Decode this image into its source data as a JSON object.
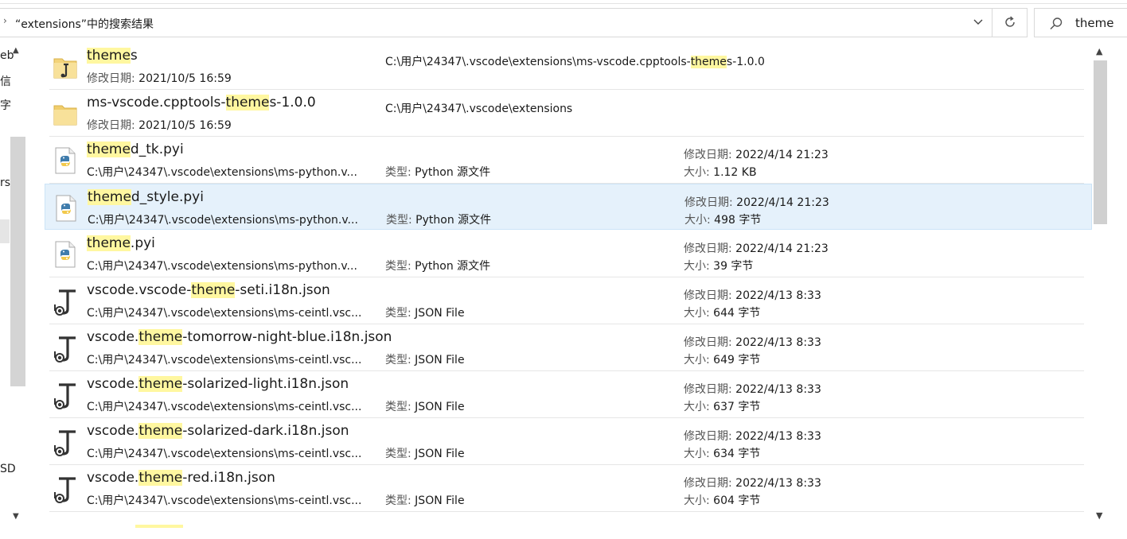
{
  "address": {
    "text": "“extensions”中的搜索结果",
    "chevron": "›"
  },
  "search": {
    "value": "theme",
    "icon": "search-icon"
  },
  "nav": {
    "fragments": [
      "eb",
      "信",
      "字",
      "rs",
      "SD"
    ]
  },
  "labels": {
    "modified": "修改日期: ",
    "size": "大小: ",
    "type": "类型: "
  },
  "scrollbar": {
    "up": "▲",
    "down": "▼"
  },
  "results": [
    {
      "name_parts": [
        {
          "t": "theme",
          "h": true
        },
        {
          "t": "s",
          "h": false
        }
      ],
      "kind": "folder-dark",
      "sub_label": "修改日期: ",
      "sub_value": "2021/10/5 16:59",
      "location_parts": [
        {
          "t": "C:\\用户\\24347\\.vscode\\extensions\\ms-vscode.cpptools-",
          "h": false
        },
        {
          "t": "theme",
          "h": true
        },
        {
          "t": "s-1.0.0",
          "h": false
        }
      ]
    },
    {
      "name_parts": [
        {
          "t": "ms-vscode.cpptools-",
          "h": false
        },
        {
          "t": "theme",
          "h": true
        },
        {
          "t": "s-1.0.0",
          "h": false
        }
      ],
      "kind": "folder",
      "sub_label": "修改日期: ",
      "sub_value": "2021/10/5 16:59",
      "location_parts": [
        {
          "t": "C:\\用户\\24347\\.vscode\\extensions",
          "h": false
        }
      ]
    },
    {
      "name_parts": [
        {
          "t": "theme",
          "h": true
        },
        {
          "t": "d_tk.pyi",
          "h": false
        }
      ],
      "kind": "python",
      "path": "C:\\用户\\24347\\.vscode\\extensions\\ms-python.v...",
      "type": "Python 源文件",
      "modified": "2022/4/14 21:23",
      "size": "1.12 KB"
    },
    {
      "name_parts": [
        {
          "t": "theme",
          "h": true
        },
        {
          "t": "d_style.pyi",
          "h": false
        }
      ],
      "kind": "python",
      "selected": true,
      "path": "C:\\用户\\24347\\.vscode\\extensions\\ms-python.v...",
      "type": "Python 源文件",
      "modified": "2022/4/14 21:23",
      "size": "498 字节"
    },
    {
      "name_parts": [
        {
          "t": "theme",
          "h": true
        },
        {
          "t": ".pyi",
          "h": false
        }
      ],
      "kind": "python",
      "path": "C:\\用户\\24347\\.vscode\\extensions\\ms-python.v...",
      "type": "Python 源文件",
      "modified": "2022/4/14 21:23",
      "size": "39 字节"
    },
    {
      "name_parts": [
        {
          "t": "vscode.vscode-",
          "h": false
        },
        {
          "t": "theme",
          "h": true
        },
        {
          "t": "-seti.i18n.json",
          "h": false
        }
      ],
      "kind": "json",
      "path": "C:\\用户\\24347\\.vscode\\extensions\\ms-ceintl.vsc...",
      "type": "JSON File",
      "modified": "2022/4/13 8:33",
      "size": "644 字节"
    },
    {
      "name_parts": [
        {
          "t": "vscode.",
          "h": false
        },
        {
          "t": "theme",
          "h": true
        },
        {
          "t": "-tomorrow-night-blue.i18n.json",
          "h": false
        }
      ],
      "kind": "json",
      "path": "C:\\用户\\24347\\.vscode\\extensions\\ms-ceintl.vsc...",
      "type": "JSON File",
      "modified": "2022/4/13 8:33",
      "size": "649 字节"
    },
    {
      "name_parts": [
        {
          "t": "vscode.",
          "h": false
        },
        {
          "t": "theme",
          "h": true
        },
        {
          "t": "-solarized-light.i18n.json",
          "h": false
        }
      ],
      "kind": "json",
      "path": "C:\\用户\\24347\\.vscode\\extensions\\ms-ceintl.vsc...",
      "type": "JSON File",
      "modified": "2022/4/13 8:33",
      "size": "637 字节"
    },
    {
      "name_parts": [
        {
          "t": "vscode.",
          "h": false
        },
        {
          "t": "theme",
          "h": true
        },
        {
          "t": "-solarized-dark.i18n.json",
          "h": false
        }
      ],
      "kind": "json",
      "path": "C:\\用户\\24347\\.vscode\\extensions\\ms-ceintl.vsc...",
      "type": "JSON File",
      "modified": "2022/4/13 8:33",
      "size": "634 字节"
    },
    {
      "name_parts": [
        {
          "t": "vscode.",
          "h": false
        },
        {
          "t": "theme",
          "h": true
        },
        {
          "t": "-red.i18n.json",
          "h": false
        }
      ],
      "kind": "json",
      "path": "C:\\用户\\24347\\.vscode\\extensions\\ms-ceintl.vsc...",
      "type": "JSON File",
      "modified": "2022/4/13 8:33",
      "size": "604 字节"
    }
  ],
  "colors": {
    "highlight": "#fff7a0",
    "selected_row": "#e5f1fb",
    "folder": "#f3d37a",
    "python_blue": "#3f7cac",
    "python_yellow": "#f2c94c"
  }
}
